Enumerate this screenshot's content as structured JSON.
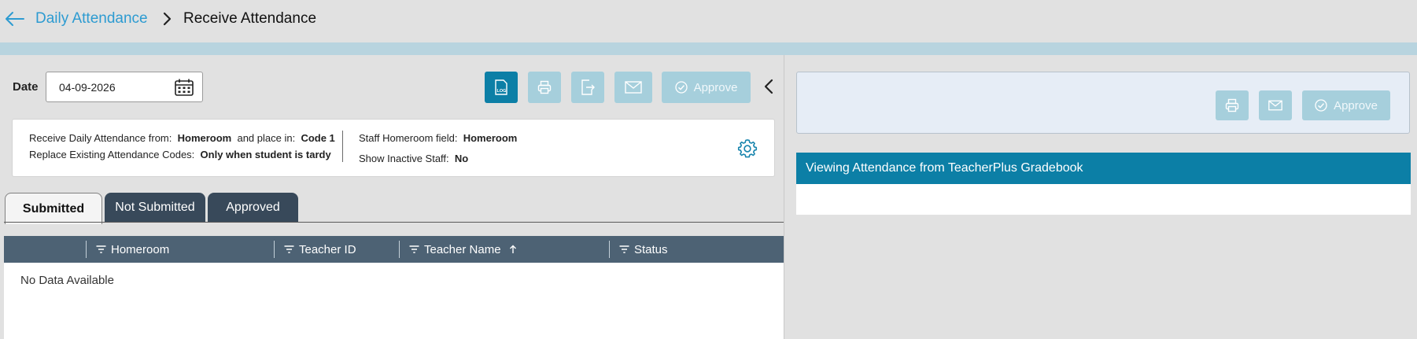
{
  "header": {
    "back_icon": "arrow-left-icon",
    "breadcrumb_parent": "Daily Attendance",
    "breadcrumb_separator_icon": "chevron-right-icon",
    "breadcrumb_current": "Receive Attendance"
  },
  "form": {
    "date_label": "Date",
    "date_value": "04-09-2026",
    "calendar_icon": "calendar-icon"
  },
  "toolbar": {
    "log_icon": "log-icon",
    "print_icon": "printer-icon",
    "export_icon": "export-icon",
    "email_icon": "email-icon",
    "approve_icon": "check-circle-icon",
    "approve_label": "Approve",
    "collapse_icon": "chevron-left-icon"
  },
  "settings": {
    "receive_from_label": "Receive Daily Attendance from:",
    "receive_from_value": "Homeroom",
    "place_in_label": "and place in:",
    "place_in_value": "Code 1",
    "replace_label": "Replace Existing Attendance Codes:",
    "replace_value": "Only when student is tardy",
    "staff_field_label": "Staff Homeroom field:",
    "staff_field_value": "Homeroom",
    "inactive_label": "Show Inactive Staff:",
    "inactive_value": "No",
    "gear_icon": "gear-icon"
  },
  "tabs": [
    {
      "label": "Submitted",
      "selected": true
    },
    {
      "label": "Not Submitted",
      "selected": false
    },
    {
      "label": "Approved",
      "selected": false
    }
  ],
  "grid": {
    "columns": [
      "Homeroom",
      "Teacher ID",
      "Teacher Name",
      "Status"
    ],
    "sorted_column": "Teacher Name",
    "sort_direction": "ascending",
    "empty_text": "No Data Available"
  },
  "right_panel": {
    "print_icon": "printer-icon",
    "email_icon": "email-icon",
    "approve_label": "Approve",
    "title": "Viewing Attendance from TeacherPlus Gradebook"
  },
  "colors": {
    "accent": "#0c7fa6",
    "link": "#2d9bd1",
    "disabled_button": "#a6cfdc",
    "grid_header": "#4d6274",
    "tab_dark": "#38495a"
  }
}
